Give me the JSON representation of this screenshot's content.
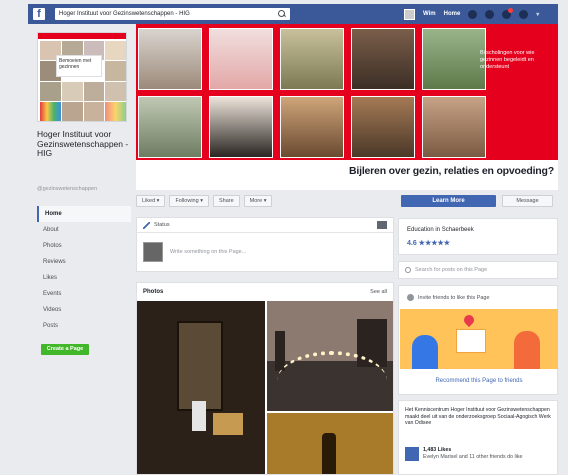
{
  "topbar": {
    "logo": "f",
    "search_value": "Hoger Instituut voor Gezinswetenschappen - HIG",
    "user_name": "Wim",
    "home_label": "Home",
    "caret": "▾"
  },
  "left": {
    "page_name": "Hoger Instituut voor Gezinswetenschappen - HIG",
    "handle": "@gezinswetenschappen",
    "profile_card_text": "Bemoeien met gezinnen",
    "nav": [
      "Home",
      "About",
      "Photos",
      "Reviews",
      "Likes",
      "Events",
      "Videos",
      "Posts"
    ],
    "create_page": "Create a Page"
  },
  "cover": {
    "side_text": "Bijscholingen voor wie gezinnen begeleidt en ondersteunt",
    "tagline": "Bijleren over gezin, relaties en opvoeding?"
  },
  "actions": {
    "liked": "Liked ▾",
    "following": "Following ▾",
    "share": "Share",
    "more": "More ▾",
    "learn_more": "Learn More",
    "message": "Message"
  },
  "status": {
    "title": "Status",
    "placeholder": "Write something on this Page..."
  },
  "photos": {
    "title": "Photos",
    "see_all": "See all"
  },
  "right": {
    "category": "Education in Schaerbeek",
    "rating": "4.6 ★★★★★",
    "search_placeholder": "Search for posts on this Page",
    "invite_title": "Invite friends to like this Page",
    "recommend": "Recommend this Page to friends",
    "about_text": "Het Kenniscentrum Hoger Instituut voor Gezinswetenschappen maakt deel uit van de onderzoeksgroep Sociaal-Agogisch Werk van Odisee",
    "likes_count": "1,483 Likes",
    "likes_friends": "Evelyn Marisel and 11 other friends do like"
  },
  "colors": {
    "brand": "#3b5998",
    "cover_red": "#e5001e",
    "button_blue": "#4267b2",
    "create_green": "#42b72a"
  }
}
